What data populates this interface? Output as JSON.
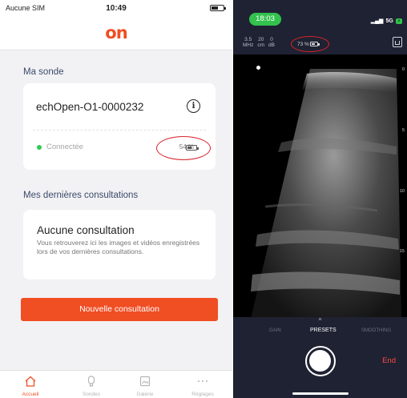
{
  "left": {
    "status": {
      "carrier": "Aucune SIM",
      "time": "10:49"
    },
    "logo": "on",
    "probe_section": {
      "title": "Ma sonde",
      "probe_name": "echOpen-O1-0000232",
      "status": "Connectée",
      "battery": "54 %",
      "battery_level": 0.54
    },
    "consult_section": {
      "title": "Mes dernières consultations",
      "empty_title": "Aucune consultation",
      "empty_desc": "Vous retrouverez ici les images et vidéos enregistrées lors de vos dernières consultations."
    },
    "new_button": "Nouvelle consultation",
    "tabs": [
      {
        "label": "Accueil",
        "icon": "home-icon",
        "active": true
      },
      {
        "label": "Sondes",
        "icon": "probe-icon",
        "active": false
      },
      {
        "label": "Galerie",
        "icon": "gallery-icon",
        "active": false
      },
      {
        "label": "Réglages",
        "icon": "more-dots-icon",
        "active": false
      }
    ]
  },
  "right": {
    "status": {
      "time": "18:03",
      "network": "5G",
      "charge_badge": "⚡"
    },
    "params": [
      {
        "value": "3.5",
        "unit": "MHz"
      },
      {
        "value": "20",
        "unit": "cm"
      },
      {
        "value": "0",
        "unit": "dB"
      }
    ],
    "battery": "73 %",
    "battery_level": 0.73,
    "depth_marks": [
      "0",
      "5",
      "10",
      "15"
    ],
    "modes": {
      "gain": "GAIN",
      "presets": "PRESETS",
      "smoothing": "SMOOTHING"
    },
    "chevron": "^",
    "end": "End"
  },
  "colors": {
    "accent": "#f04e23",
    "connected": "#2ecc52",
    "annotation": "#d8232a",
    "dark_ui": "#1f2233",
    "time_pill": "#32c24d"
  }
}
